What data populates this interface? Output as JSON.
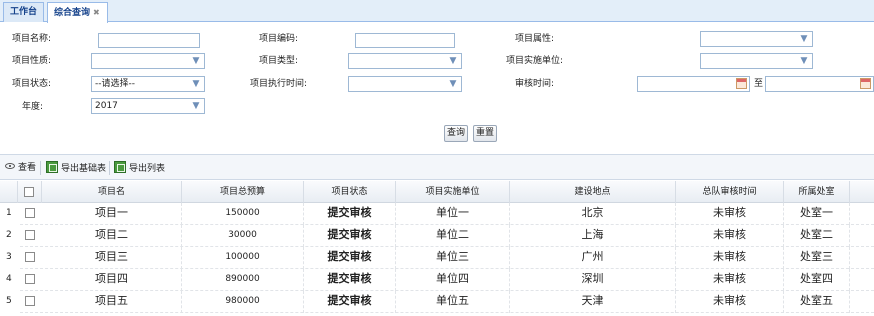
{
  "tabs": [
    {
      "label": "工作台"
    },
    {
      "label": "综合查询",
      "close": "✖"
    }
  ],
  "form": {
    "project_name": {
      "label": "项目名称:",
      "value": ""
    },
    "project_code": {
      "label": "项目编码:",
      "value": ""
    },
    "project_attr": {
      "label": "项目属性:",
      "value": ""
    },
    "project_nature": {
      "label": "项目性质:",
      "value": ""
    },
    "project_type": {
      "label": "项目类型:",
      "value": ""
    },
    "impl_unit": {
      "label": "项目实施单位:",
      "value": ""
    },
    "project_status": {
      "label": "项目状态:",
      "value": "--请选择--"
    },
    "exec_time": {
      "label": "项目执行时间:",
      "value": ""
    },
    "review_time": {
      "label": "审核时间:",
      "from": "",
      "to_label": "至",
      "to": ""
    },
    "year": {
      "label": "年度:",
      "value": "2017"
    },
    "query_button": "查询",
    "reset_button": "重置"
  },
  "toolbar": {
    "view": "查看",
    "export_base": "导出基础表",
    "export_list": "导出列表"
  },
  "table": {
    "columns": [
      "项目名",
      "项目总预算",
      "项目状态",
      "项目实施单位",
      "建设地点",
      "总队审核时间",
      "所属处室"
    ],
    "rows": [
      {
        "n": "1",
        "name": "项目一",
        "budget": "150000",
        "status": "提交审核",
        "unit": "单位一",
        "location": "北京",
        "review": "未审核",
        "dept": "处室一"
      },
      {
        "n": "2",
        "name": "项目二",
        "budget": "30000",
        "status": "提交审核",
        "unit": "单位二",
        "location": "上海",
        "review": "未审核",
        "dept": "处室二"
      },
      {
        "n": "3",
        "name": "项目三",
        "budget": "100000",
        "status": "提交审核",
        "unit": "单位三",
        "location": "广州",
        "review": "未审核",
        "dept": "处室三"
      },
      {
        "n": "4",
        "name": "项目四",
        "budget": "890000",
        "status": "提交审核",
        "unit": "单位四",
        "location": "深圳",
        "review": "未审核",
        "dept": "处室四"
      },
      {
        "n": "5",
        "name": "项目五",
        "budget": "980000",
        "status": "提交审核",
        "unit": "单位五",
        "location": "天津",
        "review": "未审核",
        "dept": "处室五"
      }
    ]
  },
  "colors": {
    "tab_text": "#15428b",
    "border": "#99bbe8"
  }
}
